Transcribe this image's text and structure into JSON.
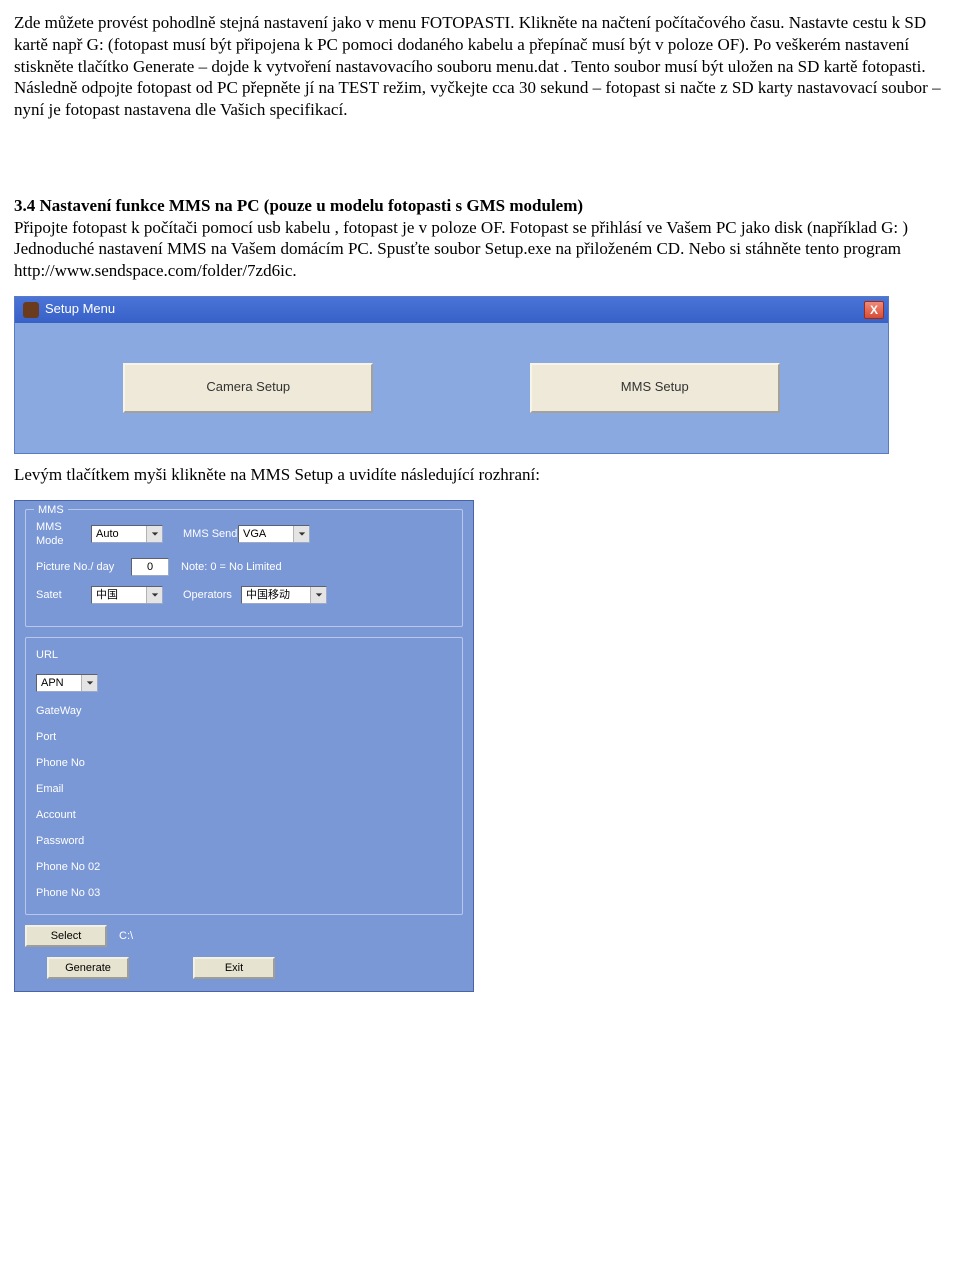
{
  "doc": {
    "p1": "Zde můžete provést pohodlně stejná nastavení jako v menu FOTOPASTI. Klikněte na načtení počítačového času. Nastavte cestu k SD kartě např G: (fotopast musí být připojena k PC pomoci dodaného kabelu a přepínač musí být v poloze OF). Po veškerém nastavení stiskněte tlačítko Generate – dojde k vytvoření nastavovacího souboru menu.dat . Tento soubor musí být uložen na SD kartě fotopasti. Následně odpojte fotopast od PC přepněte jí na TEST režim, vyčkejte cca 30 sekund – fotopast si načte z SD karty nastavovací soubor – nyní je fotopast nastavena dle Vašich specifikací.",
    "h34": "3.4 Nastavení funkce MMS na PC (pouze u modelu fotopasti s GMS modulem)",
    "p2a": "Připojte fotopast k počítači pomocí usb kabelu , fotopast je v poloze OF. Fotopast se přihlásí ve Vašem PC jako disk (například G: )",
    "p2b": "Jednoduché nastavení  MMS na Vašem domácím PC. Spusťte soubor Setup.exe na přiloženém CD. Nebo si stáhněte tento program http://www.sendspace.com/folder/7zd6ic.",
    "p3": "Levým tlačítkem myši klikněte na MMS Setup a uvidíte následující rozhraní:"
  },
  "setup": {
    "title": "Setup Menu",
    "close": "X",
    "camera_btn": "Camera Setup",
    "mms_btn": "MMS Setup"
  },
  "mms": {
    "panel1_title": "MMS",
    "mms_mode_label": "MMS Mode",
    "mms_mode_value": "Auto",
    "mms_send_label": "MMS Send",
    "mms_send_value": "VGA",
    "picno_label": "Picture No./ day",
    "picno_value": "0",
    "picno_note": "Note: 0 = No Limited",
    "satet_label": "Satet",
    "satet_value": "中国",
    "operators_label": "Operators",
    "operators_value": "中国移动",
    "url_label": "URL",
    "apn_label": "APN",
    "apn_value": "",
    "gateway_label": "GateWay",
    "port_label": "Port",
    "phone_label": "Phone No",
    "email_label": "Email",
    "account_label": "Account",
    "password_label": "Password",
    "phone02_label": "Phone No 02",
    "phone03_label": "Phone No 03",
    "select_btn": "Select",
    "path_value": "C:\\",
    "generate_btn": "Generate",
    "exit_btn": "Exit"
  }
}
